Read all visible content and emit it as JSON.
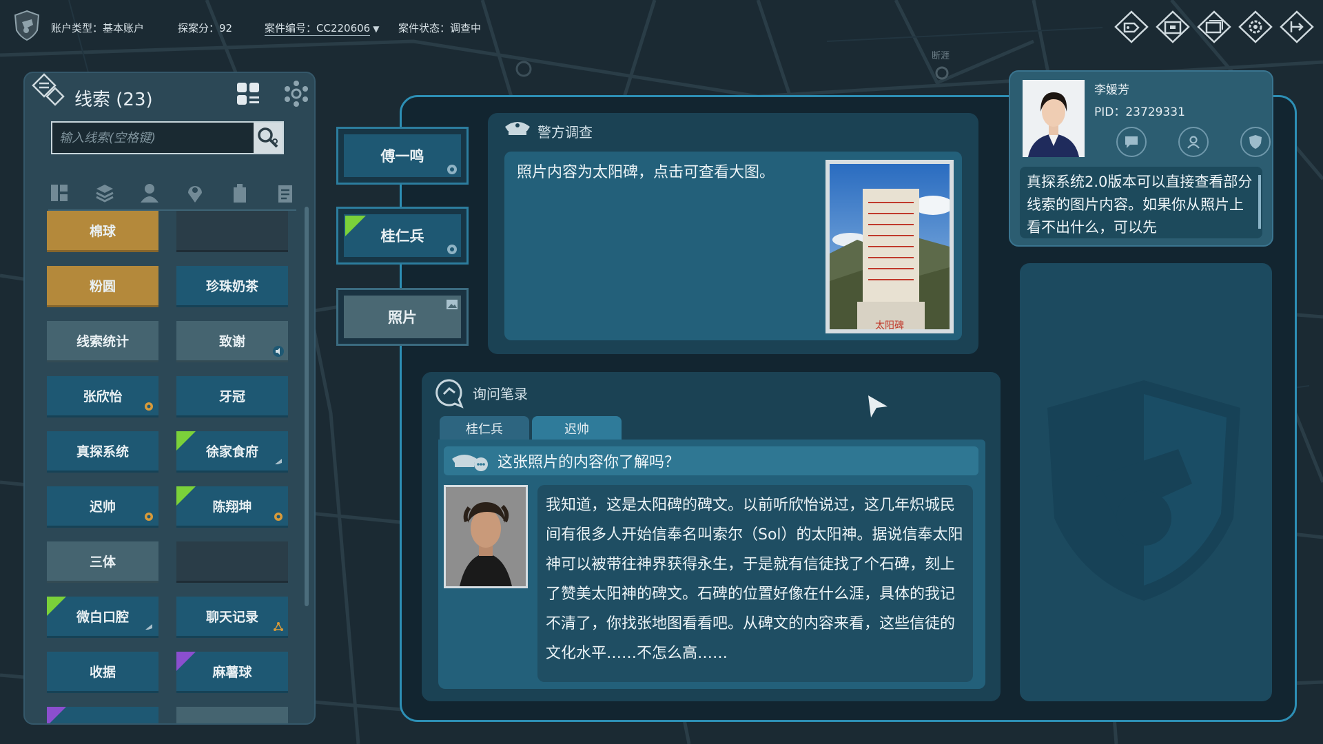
{
  "topbar": {
    "account_type": "账户类型：基本账户",
    "score": "探案分：92",
    "case_no": "案件编号：CC220606",
    "case_status": "案件状态：调查中"
  },
  "map": {
    "label": "断涯"
  },
  "clues": {
    "title": "线索 (23)",
    "search_placeholder": "输入线索(空格键)",
    "items": [
      {
        "label": "棉球",
        "style": "gold"
      },
      {
        "label": "",
        "style": "empty"
      },
      {
        "label": "粉圆",
        "style": "gold"
      },
      {
        "label": "珍珠奶茶",
        "style": "blue"
      },
      {
        "label": "线索统计",
        "style": "gray"
      },
      {
        "label": "致谢",
        "style": "gray",
        "badge": "speaker-icon"
      },
      {
        "label": "张欣怡",
        "style": "blue",
        "badge": "eye-icon"
      },
      {
        "label": "牙冠",
        "style": "blue"
      },
      {
        "label": "真探系统",
        "style": "blue"
      },
      {
        "label": "徐家食府",
        "style": "blue",
        "corner": "green",
        "badge": "pin-icon"
      },
      {
        "label": "迟帅",
        "style": "blue",
        "badge": "eye-icon"
      },
      {
        "label": "陈翔坤",
        "style": "blue",
        "corner": "green",
        "badge": "eye-icon"
      },
      {
        "label": "三体",
        "style": "gray"
      },
      {
        "label": "",
        "style": "empty"
      },
      {
        "label": "微白口腔",
        "style": "blue",
        "corner": "green",
        "badge": "pin-icon"
      },
      {
        "label": "聊天记录",
        "style": "blue",
        "badge": "link-icon"
      },
      {
        "label": "收据",
        "style": "blue"
      },
      {
        "label": "麻薯球",
        "style": "blue",
        "corner": "purple"
      }
    ]
  },
  "person_tabs": [
    {
      "label": "傅一鸣"
    },
    {
      "label": "桂仁兵"
    },
    {
      "label": "照片"
    }
  ],
  "police": {
    "title": "警方调查",
    "text": "照片内容为太阳碑，点击可查看大图。",
    "photo_caption": "太阳碑"
  },
  "inquiry": {
    "title": "询问笔录",
    "tabs": [
      "桂仁兵",
      "迟帅"
    ],
    "question": "这张照片的内容你了解吗？",
    "answer": "我知道，这是太阳碑的碑文。以前听欣怡说过，这几年炽城民间有很多人开始信奉名叫索尔（Sol）的太阳神。据说信奉太阳神可以被带往神界获得永生，于是就有信徒找了个石碑，刻上了赞美太阳神的碑文。石碑的位置好像在什么涯，具体的我记不清了，你找张地图看看吧。从碑文的内容来看，这些信徒的文化水平……不怎么高……"
  },
  "profile": {
    "name": "李媛芳",
    "pid": "PID：23729331",
    "message": "真探系统2.0版本可以直接查看部分线索的图片内容。如果你从照片上看不出什么，可以先"
  },
  "colors": {
    "accent": "#2d8fb5",
    "gold": "#b4893b",
    "clue_blue": "#1e5873",
    "green_flag": "#7bd13a",
    "purple_flag": "#8b4fcf"
  }
}
